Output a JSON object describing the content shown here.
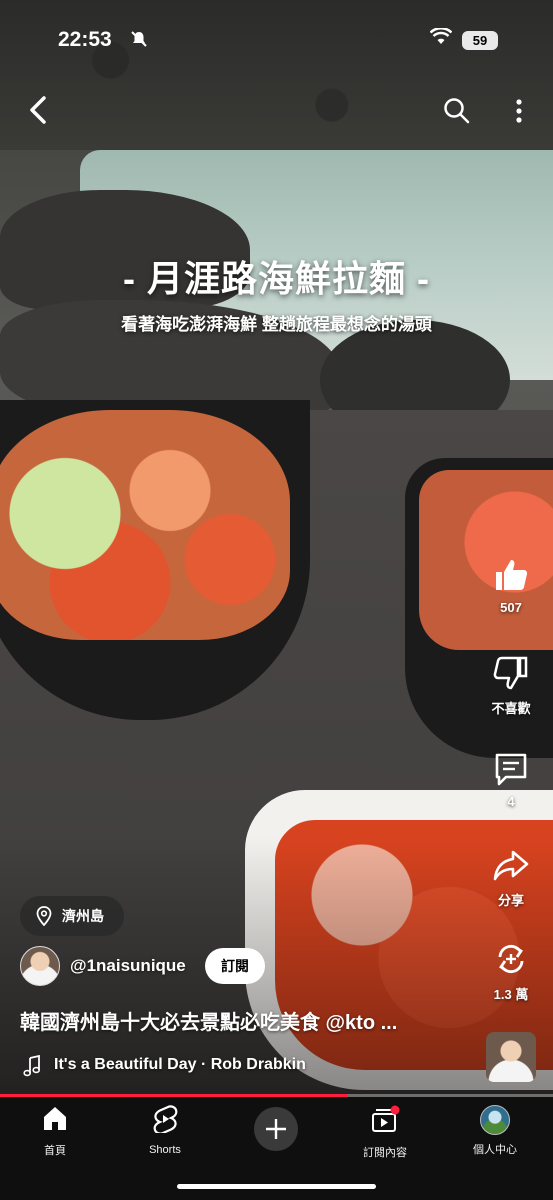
{
  "status_bar": {
    "time": "22:53",
    "battery": "59"
  },
  "video": {
    "title_main": "- 月涯路海鮮拉麵 -",
    "title_sub": "看著海吃澎湃海鮮 整趟旅程最想念的湯頭",
    "progress_percent": 63
  },
  "actions": {
    "like_count": "507",
    "dislike_label": "不喜歡",
    "comment_count": "4",
    "share_label": "分享",
    "remix_count": "1.3 萬"
  },
  "location": {
    "label": "濟州島"
  },
  "channel": {
    "handle": "@1naisunique",
    "subscribe_label": "訂閱"
  },
  "description": "韓國濟州島十大必去景點必吃美食 @kto ...",
  "music": {
    "label": "It's a Beautiful Day · Rob Drabkin"
  },
  "nav": {
    "items": [
      {
        "label": "首頁",
        "icon": "home-icon"
      },
      {
        "label": "Shorts",
        "icon": "shorts-icon"
      },
      {
        "label": "",
        "icon": "plus-icon"
      },
      {
        "label": "訂閱內容",
        "icon": "subscriptions-icon"
      },
      {
        "label": "個人中心",
        "icon": "profile-avatar"
      }
    ]
  },
  "colors": {
    "accent": "#ff1f3c",
    "nav_bg": "#0f0f0f"
  }
}
